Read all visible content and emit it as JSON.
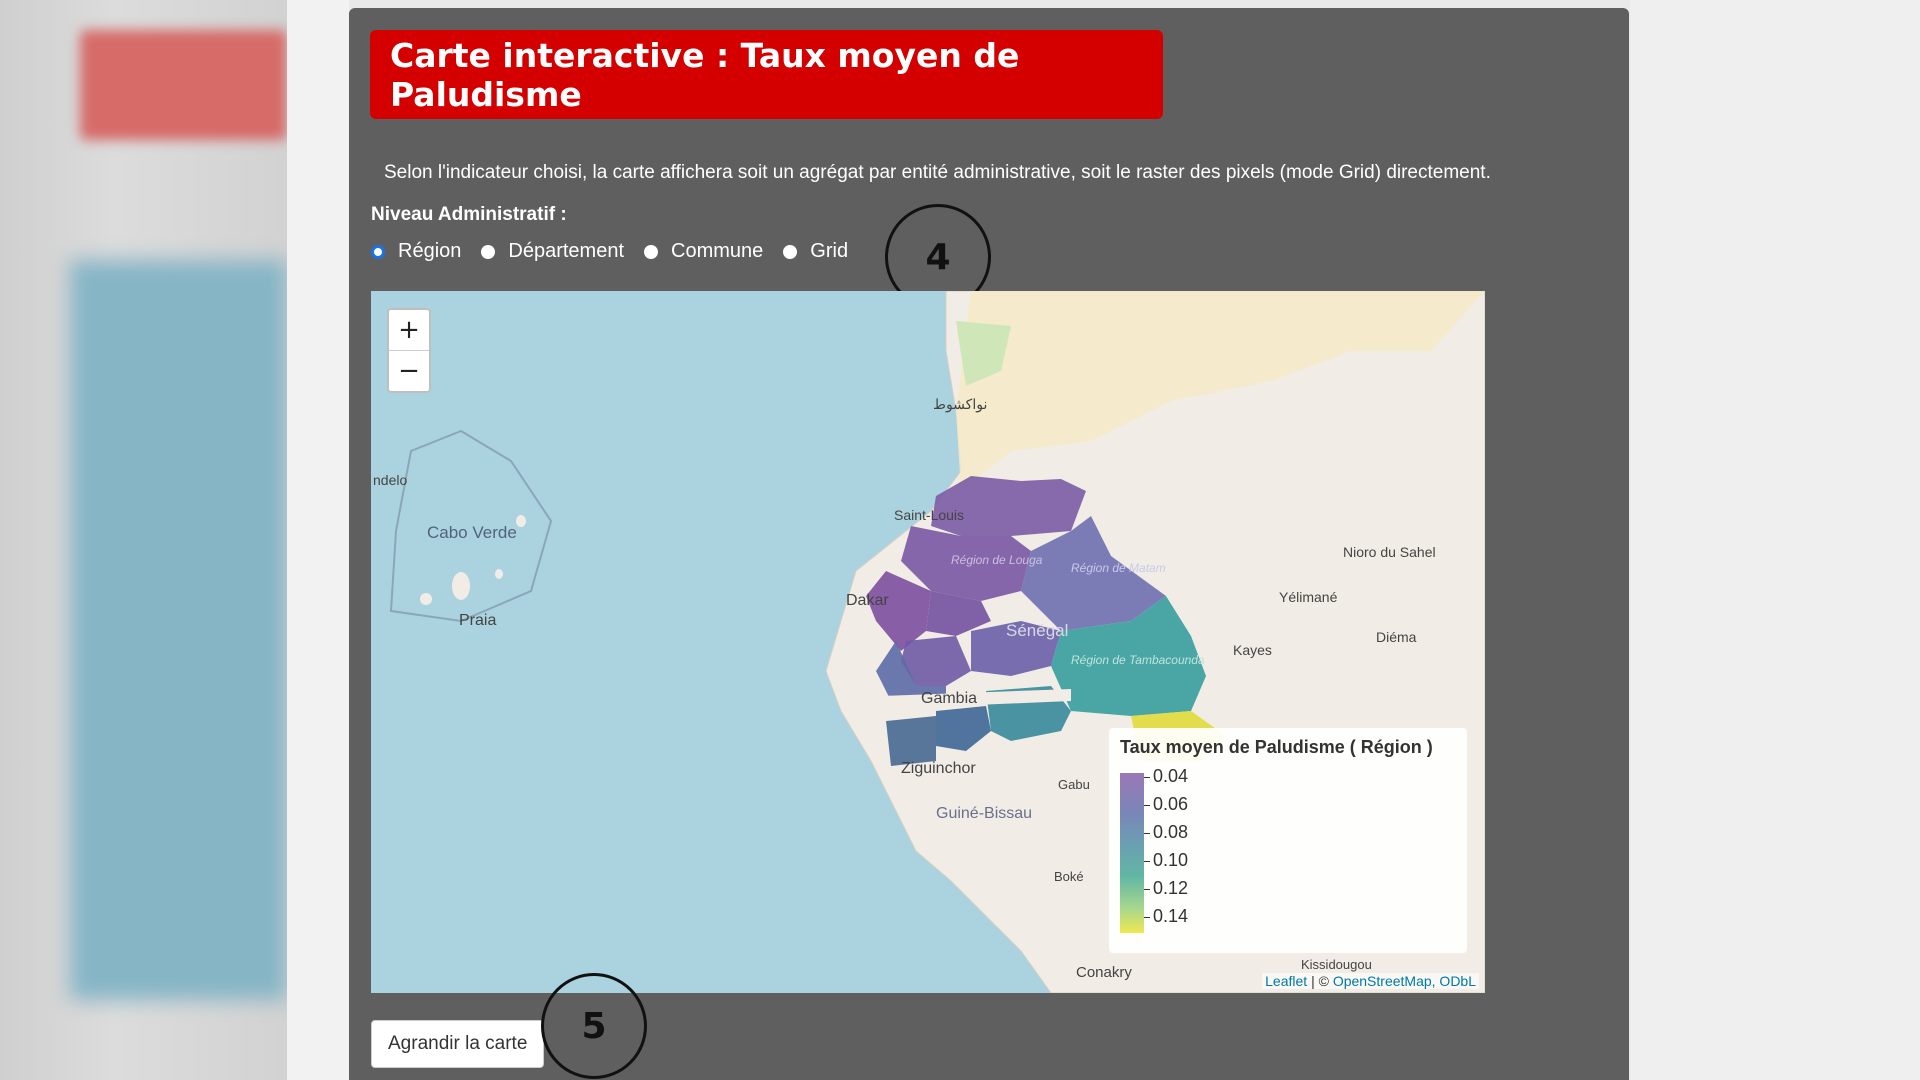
{
  "title": "Carte interactive : Taux moyen de Paludisme",
  "description": "Selon l'indicateur choisi, la carte affichera soit un agrégat par entité administrative, soit le raster des pixels (mode Grid) directement.",
  "admin_label": "Niveau Administratif :",
  "radios": [
    {
      "label": "Région",
      "selected": true
    },
    {
      "label": "Département",
      "selected": false
    },
    {
      "label": "Commune",
      "selected": false
    },
    {
      "label": "Grid",
      "selected": false
    }
  ],
  "callouts": {
    "a": "4",
    "b": "5"
  },
  "map": {
    "zoom_in": "+",
    "zoom_out": "−",
    "labels": {
      "cabo_verde": "Cabo Verde",
      "praia": "Praia",
      "mindelo": "ndelo",
      "dakar": "Dakar",
      "saint_louis": "Saint-Louis",
      "gambia": "Gambia",
      "ziguinchor": "Ziguinchor",
      "guinee_bissau": "Guiné-Bissau",
      "senegal": "Sénégal",
      "kayes": "Kayes",
      "nioro": "Nioro du Sahel",
      "yelimane": "Yélimané",
      "diema": "Diéma",
      "conakry": "Conakry",
      "boke": "Boké",
      "gabu": "Gabu",
      "kissidougou": "Kissidougou",
      "nouakchott": "نواكشوط",
      "region_louga": "Région de Louga",
      "region_matam": "Région de Matam",
      "region_tambacounda": "Région de Tambacounda"
    },
    "legend": {
      "title": "Taux moyen de Paludisme ( Région )",
      "ticks": [
        "0.04",
        "0.06",
        "0.08",
        "0.10",
        "0.12",
        "0.14"
      ]
    },
    "attribution": {
      "leaflet": "Leaflet",
      "sep": " | © ",
      "osm": "OpenStreetMap, ODbL"
    }
  },
  "enlarge_button": "Agrandir la carte"
}
